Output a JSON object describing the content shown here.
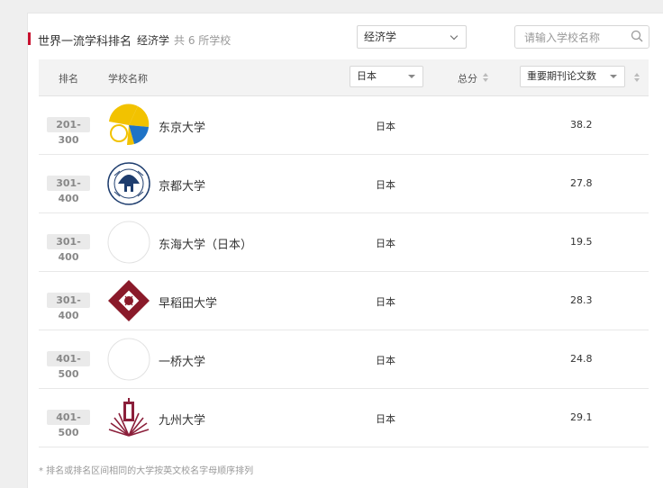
{
  "header": {
    "title": "世界一流学科排名",
    "subject": "经济学",
    "count_text": "共 6 所学校"
  },
  "filters": {
    "subject_selected": "经济学",
    "search_placeholder": "请输入学校名称"
  },
  "table": {
    "columns": {
      "rank": "排名",
      "school": "学校名称",
      "country_select": "日本",
      "total": "总分",
      "indicator_select": "重要期刊论文数"
    },
    "rows": [
      {
        "rank": "201-300",
        "name": "东京大学",
        "country": "日本",
        "value": "38.2",
        "logo": "tokyo-university-logo"
      },
      {
        "rank": "301-400",
        "name": "京都大学",
        "country": "日本",
        "value": "27.8",
        "logo": "kyoto-university-logo"
      },
      {
        "rank": "301-400",
        "name": "东海大学（日本）",
        "country": "日本",
        "value": "19.5",
        "logo": "placeholder-logo"
      },
      {
        "rank": "301-400",
        "name": "早稻田大学",
        "country": "日本",
        "value": "28.3",
        "logo": "waseda-university-logo"
      },
      {
        "rank": "401-500",
        "name": "一桥大学",
        "country": "日本",
        "value": "24.8",
        "logo": "placeholder-logo"
      },
      {
        "rank": "401-500",
        "name": "九州大学",
        "country": "日本",
        "value": "29.1",
        "logo": "kyushu-university-logo"
      }
    ]
  },
  "footnote": "* 排名或排名区间相同的大学按英文校名字母顺序排列",
  "colors": {
    "accent": "#c8102e",
    "tokyo_yellow": "#f2c200",
    "tokyo_blue": "#1f73c6",
    "kyoto_blue": "#1e3d6e",
    "waseda_red": "#8a1a2a",
    "kyushu_red": "#8b1f3a"
  }
}
